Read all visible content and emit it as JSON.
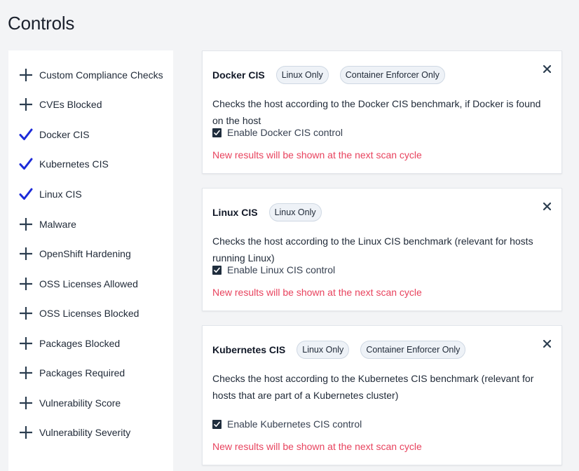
{
  "page": {
    "title": "Controls"
  },
  "sidebar": {
    "items": [
      {
        "label": "Custom Compliance Checks",
        "state": "add"
      },
      {
        "label": "CVEs Blocked",
        "state": "add"
      },
      {
        "label": "Docker CIS",
        "state": "checked"
      },
      {
        "label": "Kubernetes CIS",
        "state": "checked"
      },
      {
        "label": "Linux CIS",
        "state": "checked"
      },
      {
        "label": "Malware",
        "state": "add"
      },
      {
        "label": "OpenShift Hardening",
        "state": "add"
      },
      {
        "label": "OSS Licenses Allowed",
        "state": "add"
      },
      {
        "label": "OSS Licenses Blocked",
        "state": "add"
      },
      {
        "label": "Packages Blocked",
        "state": "add"
      },
      {
        "label": "Packages Required",
        "state": "add"
      },
      {
        "label": "Vulnerability Score",
        "state": "add"
      },
      {
        "label": "Vulnerability Severity",
        "state": "add"
      }
    ]
  },
  "cards": [
    {
      "title": "Docker CIS",
      "badges": [
        "Linux Only",
        "Container Enforcer Only"
      ],
      "description": "Checks the host according to the Docker CIS benchmark, if Docker is found on the host",
      "checkbox_label": "Enable Docker CIS control",
      "notice": "New results will be shown at the next scan cycle"
    },
    {
      "title": "Linux CIS",
      "badges": [
        "Linux Only"
      ],
      "description": "Checks the host according to the Linux CIS benchmark (relevant for hosts running Linux)",
      "checkbox_label": "Enable Linux CIS control",
      "notice": "New results will be shown at the next scan cycle"
    },
    {
      "title": "Kubernetes CIS",
      "badges": [
        "Linux Only",
        "Container Enforcer Only"
      ],
      "description": "Checks the host according to the Kubernetes CIS benchmark (relevant for hosts that are part of a Kubernetes cluster)",
      "checkbox_label": "Enable Kubernetes CIS control",
      "notice": "New results will be shown at the next scan cycle"
    }
  ],
  "colors": {
    "check_icon": "#1d2bd8",
    "plus_icon": "#2c3e50",
    "notice": "#e8435e"
  }
}
